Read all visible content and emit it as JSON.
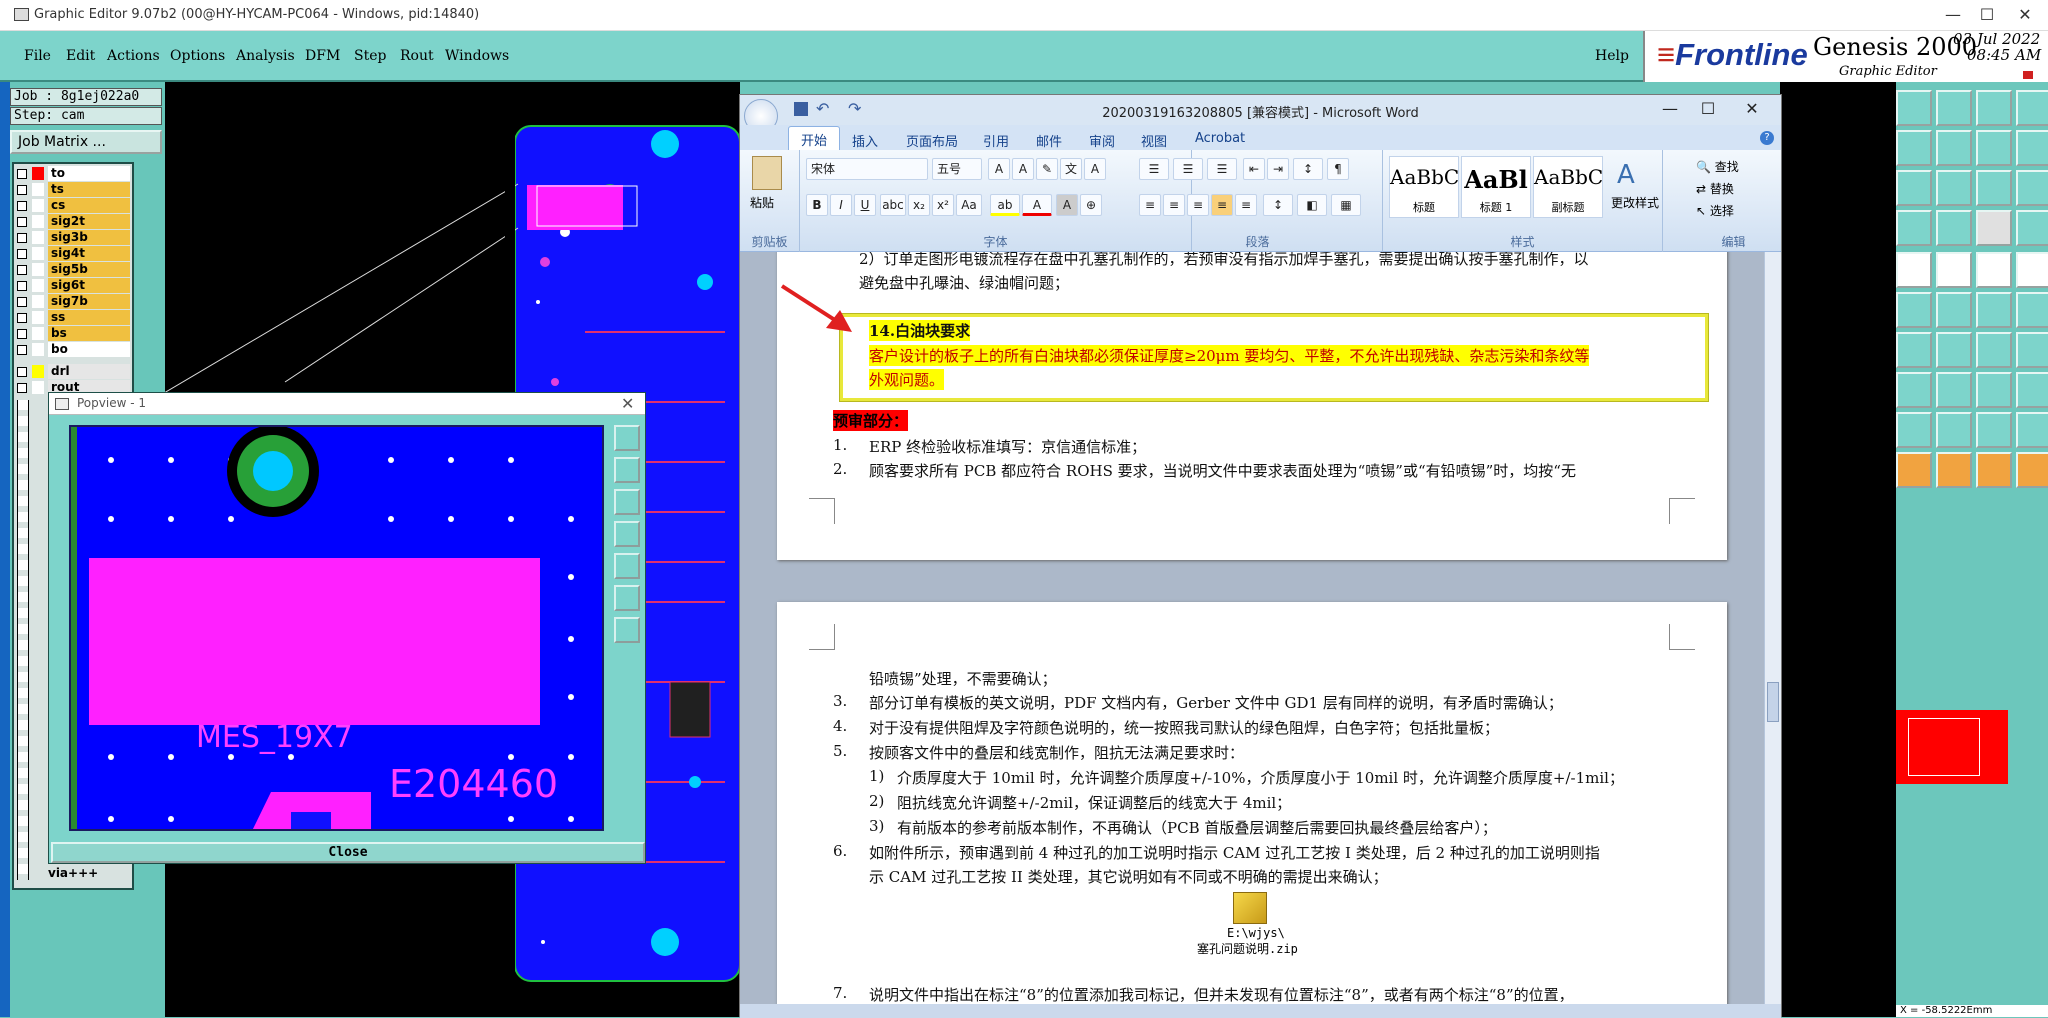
{
  "ge": {
    "title": "Graphic Editor 9.07b2 (00@HY-HYCAM-PC064 - Windows, pid:14840)",
    "menu": [
      "File",
      "Edit",
      "Actions",
      "Options",
      "Analysis",
      "DFM",
      "Step",
      "Rout",
      "Windows"
    ],
    "help": "Help",
    "brand": "Frontline",
    "product": "Genesis 2000",
    "product_sub": "Graphic Editor",
    "date": "03 Jul 2022",
    "time": "08:45 AM",
    "job_label": "Job : 8g1ej022a0",
    "step_label": "Step: cam",
    "job_matrix": "Job Matrix ...",
    "layers": [
      {
        "name": "to",
        "color": "#ffffff",
        "mark": "#ff0000"
      },
      {
        "name": "ts",
        "color": "#f0c040",
        "mark": "#ffffff"
      },
      {
        "name": "cs",
        "color": "#f0c040",
        "mark": "#ffffff"
      },
      {
        "name": "sig2t",
        "color": "#f0c040",
        "mark": "#ffffff"
      },
      {
        "name": "sig3b",
        "color": "#f0c040",
        "mark": "#ffffff"
      },
      {
        "name": "sig4t",
        "color": "#f0c040",
        "mark": "#ffffff"
      },
      {
        "name": "sig5b",
        "color": "#f0c040",
        "mark": "#ffffff"
      },
      {
        "name": "sig6t",
        "color": "#f0c040",
        "mark": "#ffffff"
      },
      {
        "name": "sig7b",
        "color": "#f0c040",
        "mark": "#ffffff"
      },
      {
        "name": "ss",
        "color": "#f0c040",
        "mark": "#ffffff"
      },
      {
        "name": "bs",
        "color": "#f0c040",
        "mark": "#ffffff"
      },
      {
        "name": "bo",
        "color": "#ffffff",
        "mark": "#ffffff"
      },
      {
        "name": "drl",
        "color": "#e6e6e6",
        "mark": "#ffff00"
      },
      {
        "name": "rout",
        "color": "#e6e6e6",
        "mark": "#ffffff"
      }
    ],
    "layer_last": "via+++",
    "popview_title": "Popview - 1",
    "popview_text1": "MES_19X7",
    "popview_text2": "E204460",
    "close": "Close",
    "coord": "X = -58.5222Emm"
  },
  "word": {
    "title": "20200319163208805 [兼容模式] - Microsoft Word",
    "tabs": [
      "开始",
      "插入",
      "页面布局",
      "引用",
      "邮件",
      "审阅",
      "视图",
      "Acrobat"
    ],
    "ribbon": {
      "paste": "粘贴",
      "clipboard": "剪贴板",
      "font_name": "宋体",
      "font_size": "五号",
      "font_group": "字体",
      "para_group": "段落",
      "styles_group": "样式",
      "edit_group": "编辑",
      "style1_preview": "AaBbC",
      "style1": "标题",
      "style2_preview": "AaBl",
      "style2": "标题 1",
      "style3_preview": "AaBbC",
      "style3": "副标题",
      "change_styles": "更改样式",
      "find": "查找",
      "replace": "替换",
      "select": "选择"
    },
    "page1": {
      "line_top_a": "2）订单走图形电镀流程存在盘中孔塞孔制作的，若预审没有指示加焊手塞孔，需要提出确认按手塞孔制作，以",
      "line_top_b": "避免盘中孔曝油、绿油帽问题；",
      "highlight_title": "14.白油块要求",
      "highlight_a": "客户设计的板子上的所有白油块都必须保证厚度≥20μm 要均匀、平整，不允许出现残缺、杂志污染和条纹等",
      "highlight_b": "外观问题。",
      "section": "预审部分：",
      "item1_num": "1.",
      "item1": "ERP 终检验收标准填写：京信通信标准；",
      "item2_num": "2.",
      "item2": "顾客要求所有 PCB 都应符合 ROHS 要求，当说明文件中要求表面处理为“喷锡”或“有铅喷锡”时，均按“无"
    },
    "page2": {
      "l0": "铅喷锡”处理，不需要确认；",
      "n3": "3.",
      "l3": "部分订单有模板的英文说明，PDF 文档内有，Gerber 文件中 GD1 层有同样的说明，有矛盾时需确认；",
      "n4": "4.",
      "l4": "对于没有提供阻焊及字符颜色说明的，统一按照我司默认的绿色阻焊，白色字符；包括批量板；",
      "n5": "5.",
      "l5": "按顾客文件中的叠层和线宽制作，阻抗无法满足要求时：",
      "s1n": "1)",
      "s1": "介质厚度大于 10mil 时，允许调整介质厚度+/-10%，介质厚度小于 10mil 时，允许调整介质厚度+/-1mil；",
      "s2n": "2)",
      "s2": "阻抗线宽允许调整+/-2mil，保证调整后的线宽大于 4mil；",
      "s3n": "3)",
      "s3": "有前版本的参考前版本制作，不再确认（PCB 首版叠层调整后需要回执最终叠层给客户）；",
      "n6": "6.",
      "l6a": "如附件所示，预审遇到前 4 种过孔的加工说明时指示 CAM 过孔工艺按 I 类处理，后 2 种过孔的加工说明则指",
      "l6b": "示 CAM 过孔工艺按 II 类处理，其它说明如有不同或不明确的需提出来确认；",
      "attach_path": "E:\\wjys\\",
      "attach_name": "塞孔问题说明.zip",
      "n7": "7.",
      "l7": "说明文件中指出在标注“8”的位置添加我司标记，但并未发现有位置标注“8”，或者有两个标注“8”的位置，"
    }
  },
  "colors": {
    "panel": "#6cc7bc",
    "highlight": "#ffff00",
    "section_bg": "#ff0000",
    "arrow": "#e02020"
  }
}
